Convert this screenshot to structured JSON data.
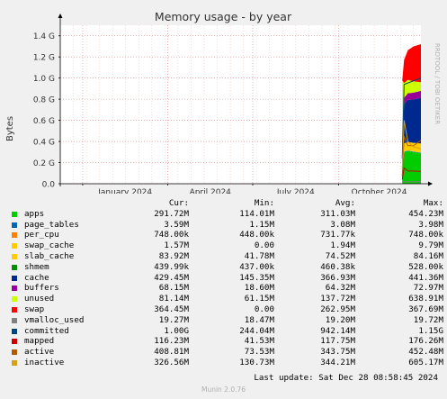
{
  "chart_data": {
    "type": "area",
    "title": "Memory usage - by year",
    "ylabel": "Bytes",
    "watermark": "RRDTOOL / TOBI OETIKER",
    "y_ticks": [
      "0.0",
      "0.2 G",
      "0.4 G",
      "0.6 G",
      "0.8 G",
      "1.0 G",
      "1.2 G",
      "1.4 G"
    ],
    "y_tick_values": [
      0,
      0.2,
      0.4,
      0.6,
      0.8,
      1.0,
      1.2,
      1.4
    ],
    "ylim": [
      0,
      1.5
    ],
    "x_ticks": [
      "January 2024",
      "April 2024",
      "July 2024",
      "October 2024"
    ],
    "x_tick_dates": [
      "2024-01-01",
      "2024-04-01",
      "2024-07-01",
      "2024-10-01"
    ],
    "x_range": [
      "2023-12-08",
      "2024-12-28"
    ],
    "data_start": "2024-12-08",
    "grid": true,
    "stack_series": [
      {
        "name": "apps",
        "color": "#00cc00",
        "x": [
          "2024-12-08",
          "2024-12-10",
          "2024-12-14",
          "2024-12-20",
          "2024-12-28"
        ],
        "values": [
          0.12,
          0.3,
          0.31,
          0.3,
          0.29
        ]
      },
      {
        "name": "page_tables",
        "color": "#0066b3",
        "x": [
          "2024-12-08",
          "2024-12-28"
        ],
        "values": [
          0.004,
          0.004
        ]
      },
      {
        "name": "per_cpu",
        "color": "#ff8000",
        "x": [
          "2024-12-08",
          "2024-12-28"
        ],
        "values": [
          0.001,
          0.001
        ]
      },
      {
        "name": "swap_cache",
        "color": "#ffcc00",
        "x": [
          "2024-12-08",
          "2024-12-28"
        ],
        "values": [
          0.002,
          0.002
        ]
      },
      {
        "name": "slab_cache",
        "color": "#ffcc00",
        "x": [
          "2024-12-08",
          "2024-12-10",
          "2024-12-28"
        ],
        "values": [
          0.04,
          0.075,
          0.084
        ]
      },
      {
        "name": "shmem",
        "color": "#008f00",
        "x": [
          "2024-12-08",
          "2024-12-28"
        ],
        "values": [
          0.0005,
          0.0005
        ]
      },
      {
        "name": "cache",
        "color": "#00298f",
        "x": [
          "2024-12-08",
          "2024-12-10",
          "2024-12-14",
          "2024-12-20",
          "2024-12-28"
        ],
        "values": [
          0.15,
          0.37,
          0.4,
          0.41,
          0.43
        ]
      },
      {
        "name": "buffers",
        "color": "#990099",
        "x": [
          "2024-12-08",
          "2024-12-10",
          "2024-12-28"
        ],
        "values": [
          0.02,
          0.06,
          0.068
        ]
      },
      {
        "name": "unused",
        "color": "#ccff00",
        "x": [
          "2024-12-08",
          "2024-12-10",
          "2024-12-28"
        ],
        "values": [
          0.64,
          0.14,
          0.081
        ]
      },
      {
        "name": "swap",
        "color": "#ff0000",
        "x": [
          "2024-12-08",
          "2024-12-10",
          "2024-12-14",
          "2024-12-20",
          "2024-12-28"
        ],
        "values": [
          0.0,
          0.22,
          0.28,
          0.33,
          0.36
        ]
      }
    ],
    "line_series": [
      {
        "name": "vmalloc_used",
        "color": "#808080",
        "x": [
          "2024-12-08",
          "2024-12-28"
        ],
        "values": [
          0.019,
          0.019
        ]
      },
      {
        "name": "committed",
        "color": "#004480",
        "x": [
          "2024-12-08",
          "2024-12-10",
          "2024-12-28"
        ],
        "values": [
          0.24,
          0.94,
          1.0
        ]
      },
      {
        "name": "mapped",
        "color": "#cc0000",
        "x": [
          "2024-12-08",
          "2024-12-10",
          "2024-12-14",
          "2024-12-20",
          "2024-12-28"
        ],
        "values": [
          0.04,
          0.15,
          0.12,
          0.12,
          0.116
        ]
      },
      {
        "name": "active",
        "color": "#b35a00",
        "x": [
          "2024-12-08",
          "2024-12-10",
          "2024-12-14",
          "2024-12-20",
          "2024-12-28"
        ],
        "values": [
          0.07,
          0.45,
          0.36,
          0.36,
          0.41
        ]
      },
      {
        "name": "inactive",
        "color": "#d4a017",
        "x": [
          "2024-12-08",
          "2024-12-10",
          "2024-12-14",
          "2024-12-20",
          "2024-12-28"
        ],
        "values": [
          0.13,
          0.6,
          0.4,
          0.35,
          0.33
        ]
      }
    ]
  },
  "legend": {
    "headers": {
      "cur": "Cur:",
      "min": "Min:",
      "avg": "Avg:",
      "max": "Max:"
    },
    "rows": [
      {
        "name": "apps",
        "color": "#00cc00",
        "cur": "291.72M",
        "min": "114.01M",
        "avg": "311.03M",
        "max": "454.23M"
      },
      {
        "name": "page_tables",
        "color": "#0066b3",
        "cur": "3.59M",
        "min": "1.15M",
        "avg": "3.08M",
        "max": "3.98M"
      },
      {
        "name": "per_cpu",
        "color": "#ff8000",
        "cur": "748.00k",
        "min": "448.00k",
        "avg": "731.77k",
        "max": "748.00k"
      },
      {
        "name": "swap_cache",
        "color": "#ffcc00",
        "cur": "1.57M",
        "min": "0.00",
        "avg": "1.94M",
        "max": "9.79M"
      },
      {
        "name": "slab_cache",
        "color": "#ffcc00",
        "cur": "83.92M",
        "min": "41.78M",
        "avg": "74.52M",
        "max": "84.16M"
      },
      {
        "name": "shmem",
        "color": "#008f00",
        "cur": "439.99k",
        "min": "437.00k",
        "avg": "460.38k",
        "max": "528.00k"
      },
      {
        "name": "cache",
        "color": "#00298f",
        "cur": "429.45M",
        "min": "145.35M",
        "avg": "366.93M",
        "max": "441.36M"
      },
      {
        "name": "buffers",
        "color": "#990099",
        "cur": "68.15M",
        "min": "18.60M",
        "avg": "64.32M",
        "max": "72.97M"
      },
      {
        "name": "unused",
        "color": "#ccff00",
        "cur": "81.14M",
        "min": "61.15M",
        "avg": "137.72M",
        "max": "638.91M"
      },
      {
        "name": "swap",
        "color": "#ff0000",
        "cur": "364.45M",
        "min": "0.00",
        "avg": "262.95M",
        "max": "367.69M"
      },
      {
        "name": "vmalloc_used",
        "color": "#808080",
        "cur": "19.27M",
        "min": "18.47M",
        "avg": "19.20M",
        "max": "19.72M"
      },
      {
        "name": "committed",
        "color": "#004480",
        "cur": "1.00G",
        "min": "244.04M",
        "avg": "942.14M",
        "max": "1.15G"
      },
      {
        "name": "mapped",
        "color": "#cc0000",
        "cur": "116.23M",
        "min": "41.53M",
        "avg": "117.75M",
        "max": "176.26M"
      },
      {
        "name": "active",
        "color": "#b35a00",
        "cur": "408.81M",
        "min": "73.53M",
        "avg": "343.75M",
        "max": "452.48M"
      },
      {
        "name": "inactive",
        "color": "#d4a017",
        "cur": "326.56M",
        "min": "130.73M",
        "avg": "344.21M",
        "max": "605.17M"
      }
    ]
  },
  "last_update": "Last update: Sat Dec 28 08:58:45 2024",
  "footer": "Munin 2.0.76"
}
